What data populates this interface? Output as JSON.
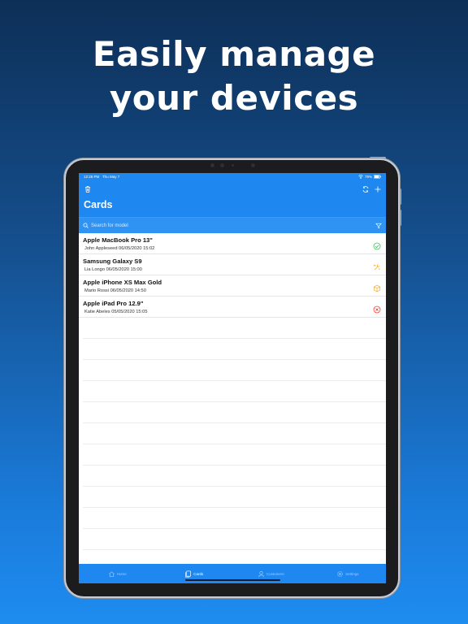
{
  "headline": {
    "line1": "Easily manage",
    "line2": "your devices"
  },
  "status": {
    "time": "12:28 PM",
    "date": "Thu May 7",
    "battery": "79%"
  },
  "nav": {
    "title": "Cards",
    "left_icon": "trash-icon",
    "right_icons": [
      "sync-icon",
      "plus-icon"
    ]
  },
  "search": {
    "placeholder": "Search for model"
  },
  "cards": [
    {
      "model": "Apple MacBook Pro 13\"",
      "sub": "John Appleseed 06/05/2020 15:02",
      "status": "check-icon",
      "color": "#34c759"
    },
    {
      "model": "Samsung Galaxy S9",
      "sub": "Lia Longo 06/05/2020 15:00",
      "status": "tools-icon",
      "color": "#f5a623"
    },
    {
      "model": "Apple iPhone XS Max Gold",
      "sub": "Mario Rossi 06/05/2020 14:50",
      "status": "box-icon",
      "color": "#f5a623"
    },
    {
      "model": "Apple iPad Pro 12.9\"",
      "sub": "Katie Abeles 05/05/2020 15:05",
      "status": "x-circle-icon",
      "color": "#ff3b30"
    }
  ],
  "tabs": [
    {
      "label": "Home",
      "icon": "home-icon",
      "active": false
    },
    {
      "label": "Cards",
      "icon": "cards-icon",
      "active": true
    },
    {
      "label": "Customers",
      "icon": "person-icon",
      "active": false
    },
    {
      "label": "Settings",
      "icon": "gear-icon",
      "active": false
    }
  ],
  "colors": {
    "accent": "#1e88f0",
    "success": "#34c759",
    "warning": "#f5a623",
    "danger": "#ff3b30"
  }
}
